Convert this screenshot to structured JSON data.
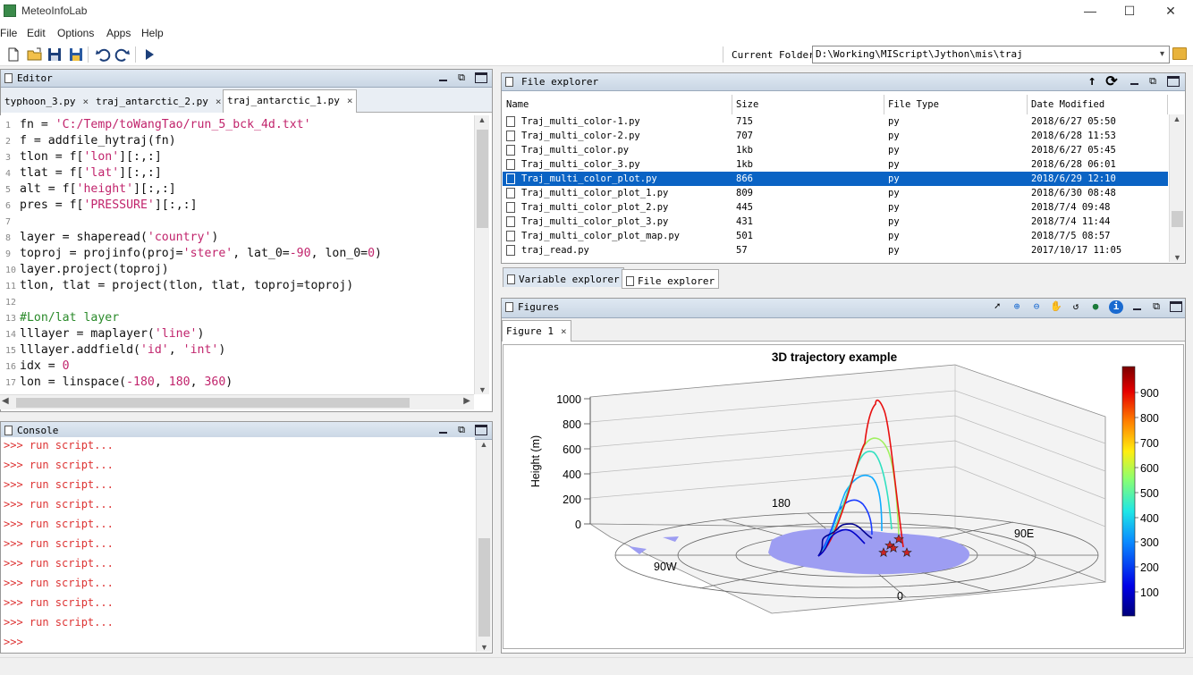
{
  "app": {
    "title": "MeteoInfoLab"
  },
  "menu": [
    "File",
    "Edit",
    "Options",
    "Apps",
    "Help"
  ],
  "window_controls": {
    "minimize": "—",
    "maximize": "☐",
    "close": "✕"
  },
  "toolbar": {
    "icons": [
      "new-file-icon",
      "open-folder-icon",
      "save-icon",
      "save-all-icon",
      "undo-icon",
      "redo-icon",
      "run-icon"
    ],
    "current_folder_label": "Current Folder:",
    "current_folder_value": "D:\\Working\\MIScript\\Jython\\mis\\traj"
  },
  "editor": {
    "title": "Editor",
    "tabs": [
      {
        "label": "typhoon_3.py",
        "active": false
      },
      {
        "label": "traj_antarctic_2.py",
        "active": false
      },
      {
        "label": "traj_antarctic_1.py",
        "active": true
      }
    ],
    "lines": [
      {
        "n": "1",
        "parts": [
          [
            "fn = ",
            "t"
          ],
          [
            "'C:/Temp/toWangTao/run_5_bck_4d.txt'",
            "s"
          ]
        ]
      },
      {
        "n": "2",
        "parts": [
          [
            "f = addfile_hytraj(fn)",
            "t"
          ]
        ]
      },
      {
        "n": "3",
        "parts": [
          [
            "tlon = f[",
            "t"
          ],
          [
            "'lon'",
            "s"
          ],
          [
            "][:,:]",
            "t"
          ]
        ]
      },
      {
        "n": "4",
        "parts": [
          [
            "tlat = f[",
            "t"
          ],
          [
            "'lat'",
            "s"
          ],
          [
            "][:,:]",
            "t"
          ]
        ]
      },
      {
        "n": "5",
        "parts": [
          [
            "alt = f[",
            "t"
          ],
          [
            "'height'",
            "s"
          ],
          [
            "][:,:]",
            "t"
          ]
        ]
      },
      {
        "n": "6",
        "parts": [
          [
            "pres = f[",
            "t"
          ],
          [
            "'PRESSURE'",
            "s"
          ],
          [
            "][:,:]",
            "t"
          ]
        ]
      },
      {
        "n": "7",
        "parts": []
      },
      {
        "n": "8",
        "parts": [
          [
            "layer = shaperead(",
            "t"
          ],
          [
            "'country'",
            "s"
          ],
          [
            ")",
            "t"
          ]
        ]
      },
      {
        "n": "9",
        "parts": [
          [
            "toproj = projinfo(proj=",
            "t"
          ],
          [
            "'stere'",
            "s"
          ],
          [
            ", lat_0=",
            "t"
          ],
          [
            "-90",
            "s"
          ],
          [
            ", lon_0=",
            "t"
          ],
          [
            "0",
            "s"
          ],
          [
            ")",
            "t"
          ]
        ]
      },
      {
        "n": "10",
        "parts": [
          [
            "layer.project(toproj)",
            "t"
          ]
        ]
      },
      {
        "n": "11",
        "parts": [
          [
            "tlon, tlat = project(tlon, tlat, toproj=toproj)",
            "t"
          ]
        ]
      },
      {
        "n": "12",
        "parts": []
      },
      {
        "n": "13",
        "parts": [
          [
            "#Lon/lat layer",
            "c"
          ]
        ]
      },
      {
        "n": "14",
        "parts": [
          [
            "lllayer = maplayer(",
            "t"
          ],
          [
            "'line'",
            "s"
          ],
          [
            ")",
            "t"
          ]
        ]
      },
      {
        "n": "15",
        "parts": [
          [
            "lllayer.addfield(",
            "t"
          ],
          [
            "'id'",
            "s"
          ],
          [
            ", ",
            "t"
          ],
          [
            "'int'",
            "s"
          ],
          [
            ")",
            "t"
          ]
        ]
      },
      {
        "n": "16",
        "parts": [
          [
            "idx = ",
            "t"
          ],
          [
            "0",
            "s"
          ]
        ]
      },
      {
        "n": "17",
        "parts": [
          [
            "lon = linspace(",
            "t"
          ],
          [
            "-180",
            "s"
          ],
          [
            ", ",
            "t"
          ],
          [
            "180",
            "s"
          ],
          [
            ", ",
            "t"
          ],
          [
            "360",
            "s"
          ],
          [
            ")",
            "t"
          ]
        ]
      }
    ]
  },
  "console": {
    "title": "Console",
    "lines": [
      ">>> run script...",
      ">>> run script...",
      ">>> run script...",
      ">>> run script...",
      ">>> run script...",
      ">>> run script...",
      ">>> run script...",
      ">>> run script...",
      ">>> run script...",
      ">>> run script...",
      ">>>"
    ]
  },
  "file_explorer": {
    "title": "File explorer",
    "columns": [
      "Name",
      "Size",
      "File Type",
      "Date Modified"
    ],
    "rows": [
      {
        "name": "Traj_multi_color-1.py",
        "size": "715",
        "type": "py",
        "date": "2018/6/27 05:50",
        "selected": false
      },
      {
        "name": "Traj_multi_color-2.py",
        "size": "707",
        "type": "py",
        "date": "2018/6/28 11:53",
        "selected": false
      },
      {
        "name": "Traj_multi_color.py",
        "size": "1kb",
        "type": "py",
        "date": "2018/6/27 05:45",
        "selected": false
      },
      {
        "name": "Traj_multi_color_3.py",
        "size": "1kb",
        "type": "py",
        "date": "2018/6/28 06:01",
        "selected": false
      },
      {
        "name": "Traj_multi_color_plot.py",
        "size": "866",
        "type": "py",
        "date": "2018/6/29 12:10",
        "selected": true
      },
      {
        "name": "Traj_multi_color_plot_1.py",
        "size": "809",
        "type": "py",
        "date": "2018/6/30 08:48",
        "selected": false
      },
      {
        "name": "Traj_multi_color_plot_2.py",
        "size": "445",
        "type": "py",
        "date": "2018/7/4 09:48",
        "selected": false
      },
      {
        "name": "Traj_multi_color_plot_3.py",
        "size": "431",
        "type": "py",
        "date": "2018/7/4 11:44",
        "selected": false
      },
      {
        "name": "Traj_multi_color_plot_map.py",
        "size": "501",
        "type": "py",
        "date": "2018/7/5 08:57",
        "selected": false
      },
      {
        "name": "traj_read.py",
        "size": "57",
        "type": "py",
        "date": "2017/10/17 11:05",
        "selected": false
      }
    ],
    "bottom_tabs": [
      "Variable explorer",
      "File explorer"
    ]
  },
  "figures": {
    "title": "Figures",
    "tab": "Figure 1",
    "plot_title": "3D trajectory example",
    "zlabel": "Height (m)",
    "z_ticks": [
      "1000",
      "800",
      "600",
      "400",
      "200",
      "0"
    ],
    "map_labels": {
      "north": "180",
      "west": "90W",
      "east": "90E",
      "south": "0"
    },
    "colorbar_ticks": [
      "900",
      "800",
      "700",
      "600",
      "500",
      "400",
      "300",
      "200",
      "100"
    ],
    "colors": {
      "colorbar_top": "#7a0000",
      "colorbar_bottom": "#00007a",
      "land": "#9d9df2"
    }
  }
}
